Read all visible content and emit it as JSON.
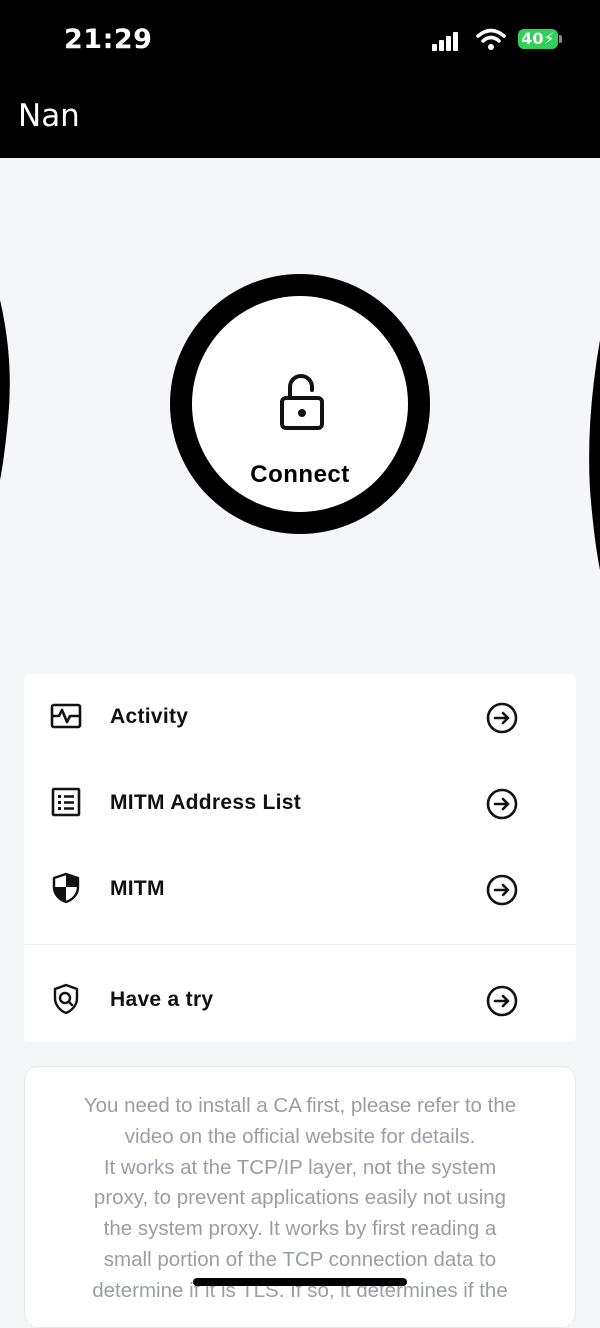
{
  "status_bar": {
    "time": "21:29",
    "battery": "40"
  },
  "header": {
    "title": "Nan"
  },
  "connect": {
    "label": "Connect"
  },
  "menu": {
    "items": [
      {
        "label": "Activity",
        "icon": "activity-icon"
      },
      {
        "label": "MITM Address List",
        "icon": "list-icon"
      },
      {
        "label": "MITM",
        "icon": "shield-icon"
      },
      {
        "label": "Have a try",
        "icon": "search-shield-icon"
      }
    ]
  },
  "info": {
    "lines": [
      "You need to install a CA first, please refer to the",
      "video on the official website for details.",
      "It works at the TCP/IP layer, not the system",
      "proxy, to prevent applications easily not using",
      "the system proxy. It works by first reading a",
      "small portion of the TCP connection data to",
      "determine if it is TLS. If so, it determines if the"
    ]
  },
  "colors": {
    "header_bg": "#000000",
    "page_bg": "#f5f6f8",
    "battery": "#30d158",
    "info_text": "#9a9ea4"
  }
}
